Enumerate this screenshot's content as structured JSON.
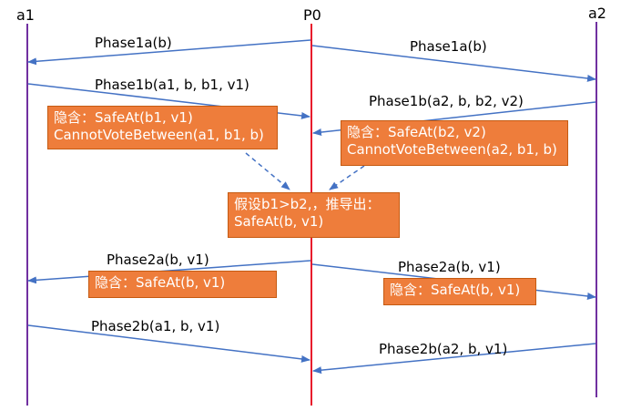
{
  "participants": [
    {
      "id": "a1",
      "label": "a1",
      "color": "#7030a0"
    },
    {
      "id": "p0",
      "label": "P0",
      "color": "#e8192c"
    },
    {
      "id": "a2",
      "label": "a2",
      "color": "#7030a0"
    }
  ],
  "messages": [
    {
      "label": "Phase1a(b)",
      "from": "P0",
      "to": "a1"
    },
    {
      "label": "Phase1a(b)",
      "from": "P0",
      "to": "a2"
    },
    {
      "label": "Phase1b(a1, b, b1, v1)",
      "from": "a1",
      "to": "P0"
    },
    {
      "label": "Phase1b(a2, b, b2, v2)",
      "from": "a2",
      "to": "P0"
    },
    {
      "label": "Phase2a(b, v1)",
      "from": "P0",
      "to": "a1"
    },
    {
      "label": "Phase2a(b, v1)",
      "from": "P0",
      "to": "a2"
    },
    {
      "label": "Phase2b(a1, b, v1)",
      "from": "a1",
      "to": "P0"
    },
    {
      "label": "Phase2b(a2, b, v1)",
      "from": "a2",
      "to": "P0"
    }
  ],
  "notes": {
    "implied_a1": {
      "line1": "隐含：SafeAt(b1, v1)",
      "line2": "CannotVoteBetween(a1, b1, b)"
    },
    "implied_a2": {
      "line1": "隐含：SafeAt(b2, v2)",
      "line2": "CannotVoteBetween(a2, b1, b)"
    },
    "deduction": {
      "line1": "假设b1>b2,，推导出：",
      "line2": "SafeAt(b, v1)"
    },
    "phase2a_a1": {
      "line1": "隐含：SafeAt(b, v1)"
    },
    "phase2a_a2": {
      "line1": "隐含：SafeAt(b, v1)"
    }
  },
  "colors": {
    "arrow": "#4472c4",
    "note_fill": "#ee7d3b",
    "note_border": "#c55a11"
  }
}
